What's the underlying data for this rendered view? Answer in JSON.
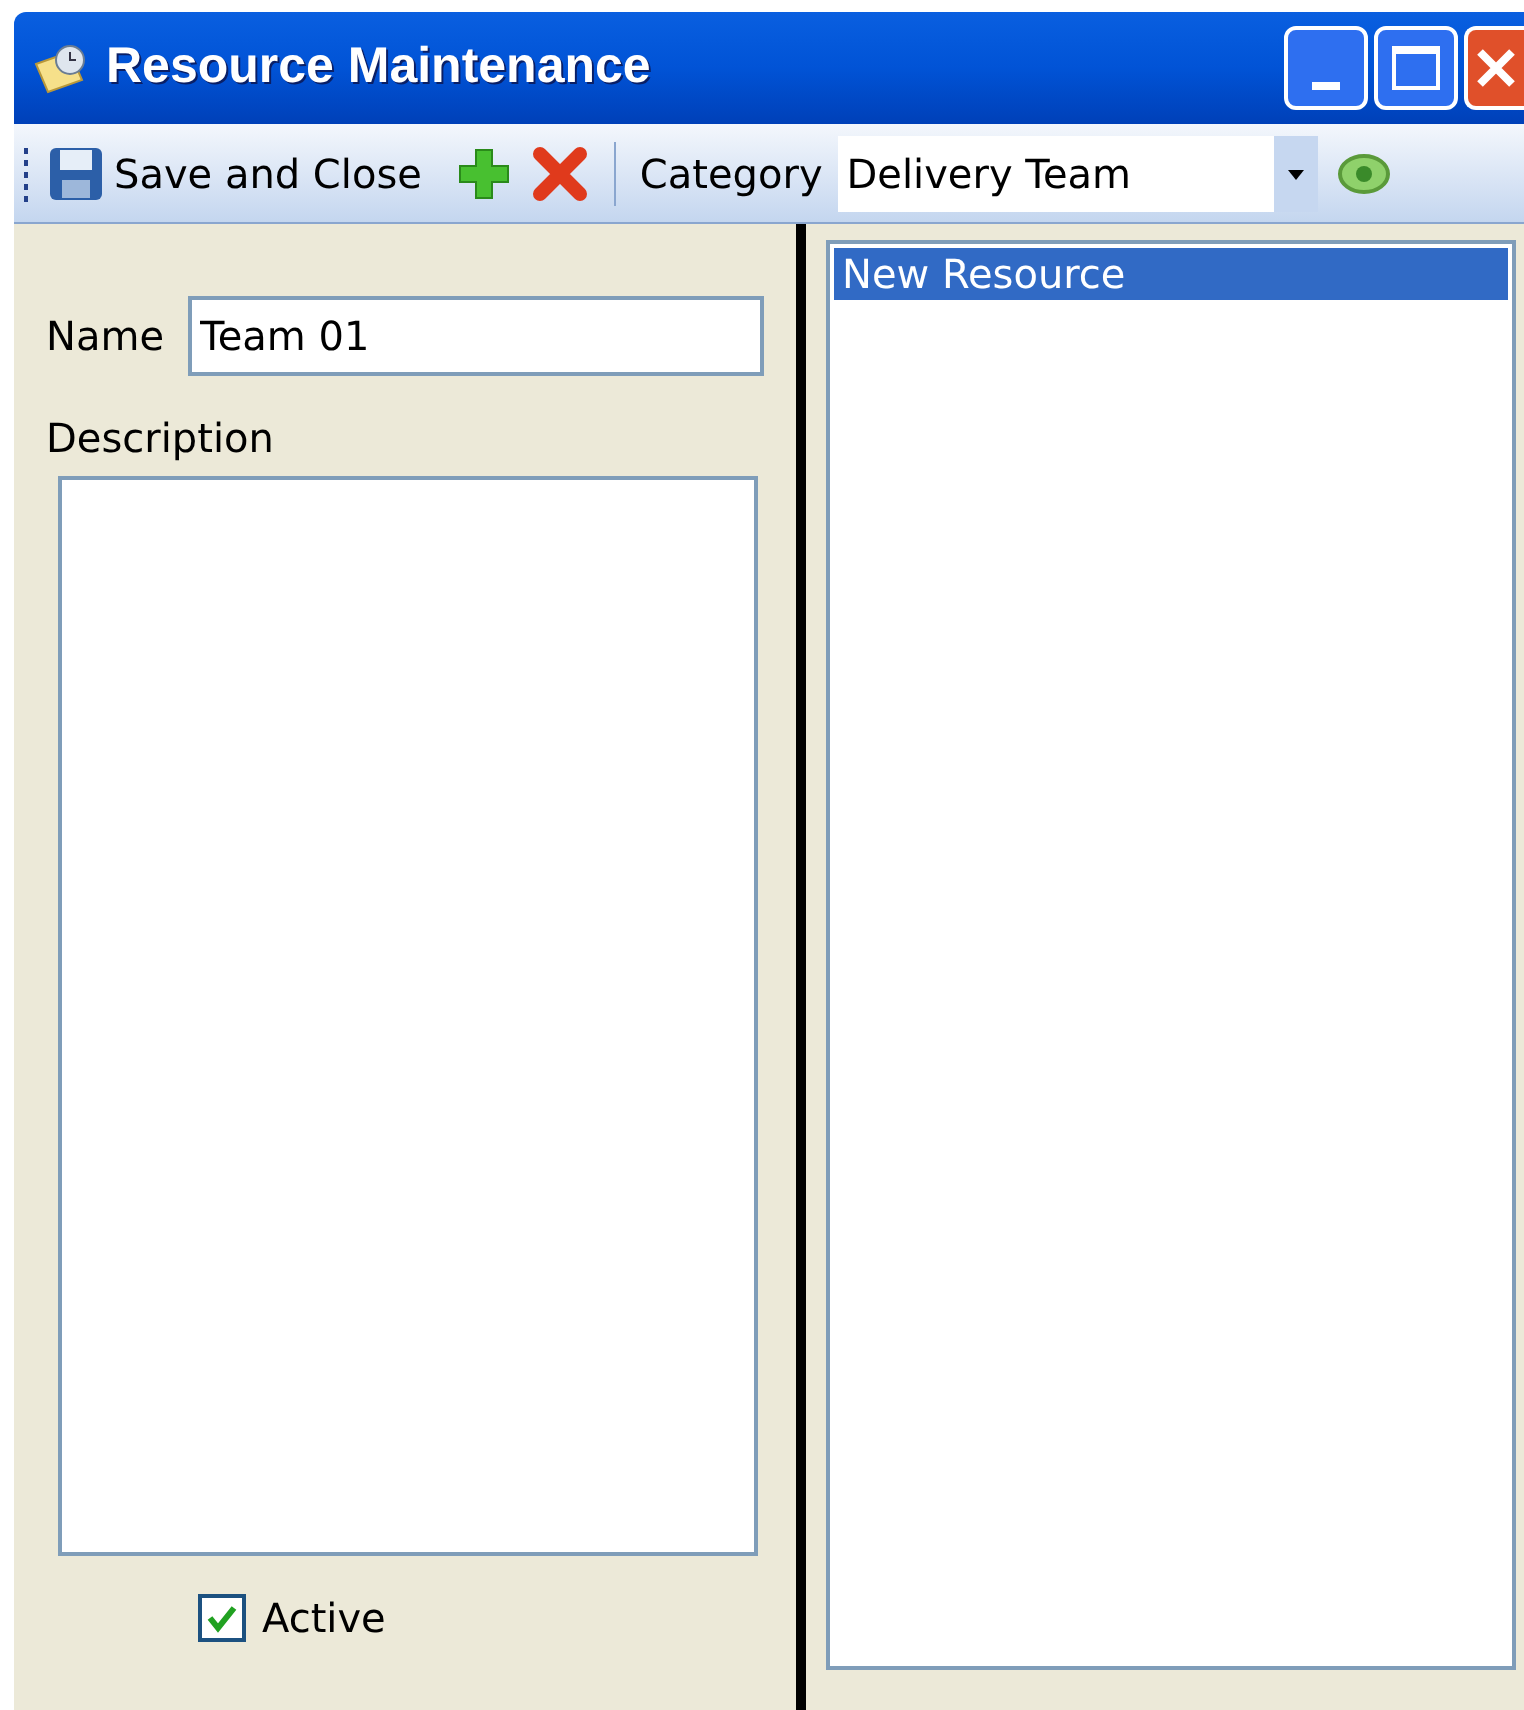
{
  "window": {
    "title": "Resource Maintenance"
  },
  "toolbar": {
    "save_label": "Save and Close",
    "category_label": "Category",
    "category_value": "Delivery Team"
  },
  "form": {
    "name_label": "Name",
    "name_value": "Team 01",
    "description_label": "Description",
    "active": {
      "label": "Active",
      "checked": true
    }
  },
  "resources": [
    {
      "label": "New Resource",
      "selected": true
    }
  ]
}
